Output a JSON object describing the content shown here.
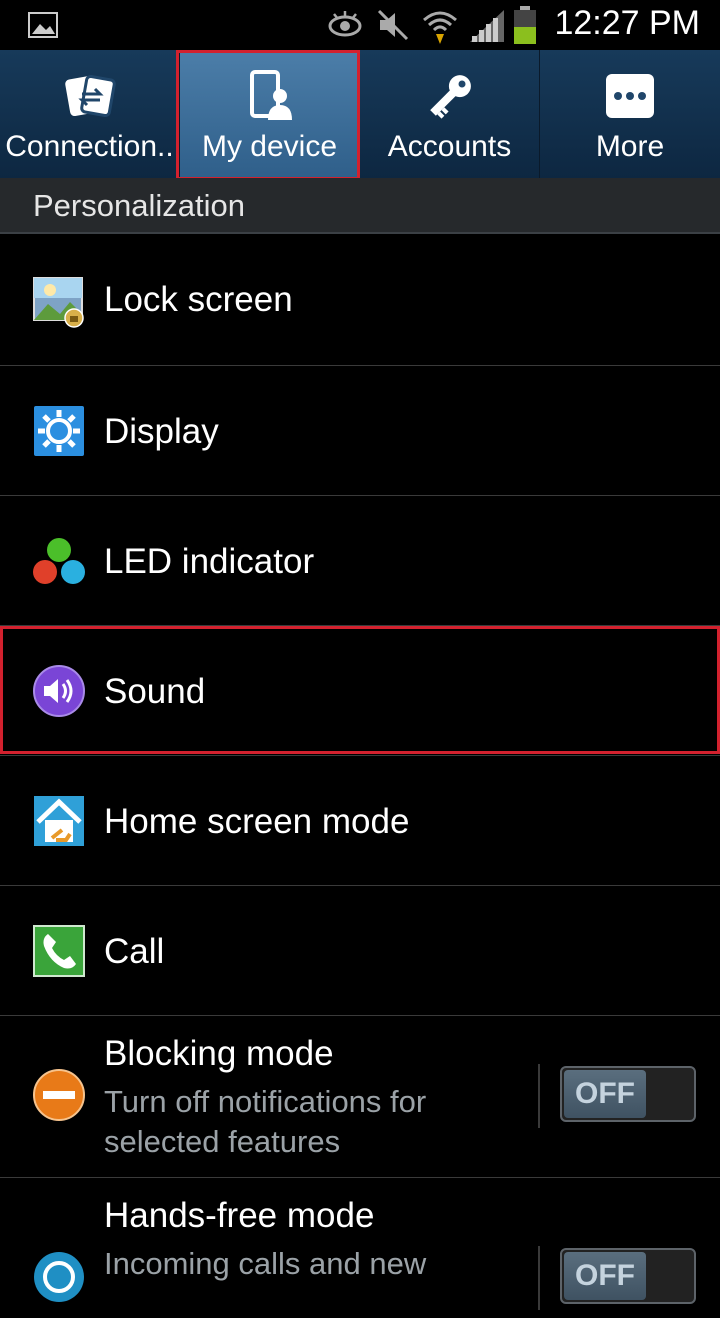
{
  "status": {
    "time": "12:27 PM"
  },
  "tabs": [
    {
      "label": "Connection..",
      "icon": "connections-icon",
      "selected": false
    },
    {
      "label": "My device",
      "icon": "my-device-icon",
      "selected": true
    },
    {
      "label": "Accounts",
      "icon": "accounts-key-icon",
      "selected": false
    },
    {
      "label": "More",
      "icon": "more-dots-icon",
      "selected": false
    }
  ],
  "section": {
    "title": "Personalization"
  },
  "rows": [
    {
      "label": "Lock screen",
      "icon": "lock-screen-icon"
    },
    {
      "label": "Display",
      "icon": "display-gear-icon"
    },
    {
      "label": "LED indicator",
      "icon": "led-dots-icon"
    },
    {
      "label": "Sound",
      "icon": "sound-speaker-icon"
    },
    {
      "label": "Home screen mode",
      "icon": "home-screen-icon"
    },
    {
      "label": "Call",
      "icon": "call-phone-icon"
    },
    {
      "label": "Blocking mode",
      "sub": "Turn off notifications for selected features",
      "icon": "blocking-mode-icon",
      "toggle": "OFF"
    },
    {
      "label": "Hands-free mode",
      "sub": "Incoming calls and new",
      "icon": "hands-free-icon",
      "toggle": "OFF"
    }
  ],
  "colors": {
    "highlight": "#d3212e",
    "tab_bg": "#173a5a",
    "tab_selected": "#3f6f9b",
    "section_bg": "#26292c"
  }
}
